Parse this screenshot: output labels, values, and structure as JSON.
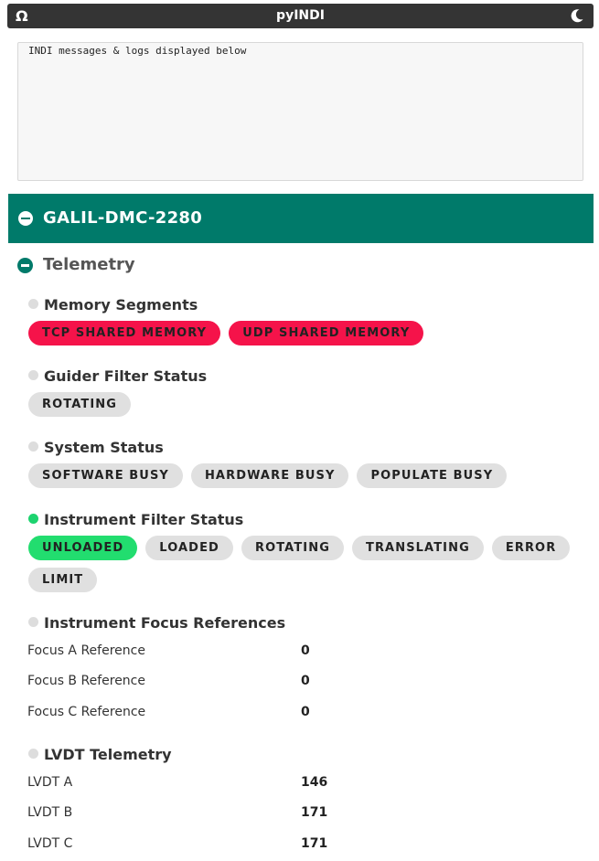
{
  "app": {
    "title": "pyINDI",
    "logo_icon": "omega-icon",
    "theme_icon": "moon-icon"
  },
  "log": {
    "text": "INDI messages & logs displayed below"
  },
  "device": {
    "name": "GALIL-DMC-2280",
    "color": "#007a6a"
  },
  "group": {
    "name": "Telemetry"
  },
  "properties": {
    "memory_segments": {
      "label": "Memory Segments",
      "state": "idle",
      "buttons": [
        "TCP SHARED MEMORY",
        "UDP SHARED MEMORY"
      ]
    },
    "guider_filter_status": {
      "label": "Guider Filter Status",
      "state": "idle",
      "buttons": [
        "ROTATING"
      ]
    },
    "system_status": {
      "label": "System Status",
      "state": "idle",
      "buttons": [
        "SOFTWARE BUSY",
        "HARDWARE BUSY",
        "POPULATE BUSY"
      ]
    },
    "instrument_filter_status": {
      "label": "Instrument Filter Status",
      "state": "ok",
      "buttons": [
        "UNLOADED",
        "LOADED",
        "ROTATING",
        "TRANSLATING",
        "ERROR",
        "LIMIT"
      ]
    },
    "instrument_focus_references": {
      "label": "Instrument Focus References",
      "state": "idle",
      "rows": [
        {
          "label": "Focus A Reference",
          "value": "0"
        },
        {
          "label": "Focus B Reference",
          "value": "0"
        },
        {
          "label": "Focus C Reference",
          "value": "0"
        }
      ]
    },
    "lvdt_telemetry": {
      "label": "LVDT Telemetry",
      "state": "idle",
      "rows": [
        {
          "label": "LVDT A",
          "value": "146"
        },
        {
          "label": "LVDT B",
          "value": "171"
        },
        {
          "label": "LVDT C",
          "value": "171"
        }
      ]
    }
  },
  "colors": {
    "alert": "#f5134a",
    "ok": "#22dd6f",
    "idle": "#e0e0e0"
  }
}
